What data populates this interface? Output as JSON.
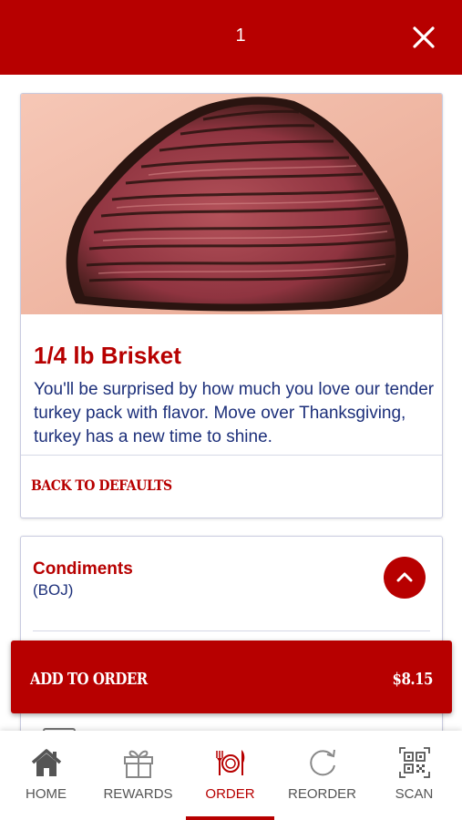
{
  "header": {
    "count": "1",
    "close_icon": "close-icon"
  },
  "item": {
    "image_alt": "sliced smoked brisket",
    "title": "1/4 lb Brisket",
    "description": "You'll be surprised by how much you love our tender turkey pack with flavor. Move over Thanksgiving, turkey has a new time to shine.",
    "back_to_defaults": "BACK TO DEFAULTS"
  },
  "condiments": {
    "title": "Condiments",
    "subtitle": "(BOJ)",
    "toggle_icon": "chevron-up-icon"
  },
  "add_to_order": {
    "label": "ADD TO ORDER",
    "price": "$8.15"
  },
  "tabs": [
    {
      "label": "HOME",
      "icon": "home-icon"
    },
    {
      "label": "REWARDS",
      "icon": "gift-icon"
    },
    {
      "label": "ORDER",
      "icon": "utensils-icon",
      "active": true
    },
    {
      "label": "REORDER",
      "icon": "refresh-icon"
    },
    {
      "label": "SCAN",
      "icon": "qr-code-icon"
    }
  ],
  "colors": {
    "brand_red": "#b70000",
    "text_navy": "#1c2f7a",
    "tab_gray": "#555555"
  }
}
